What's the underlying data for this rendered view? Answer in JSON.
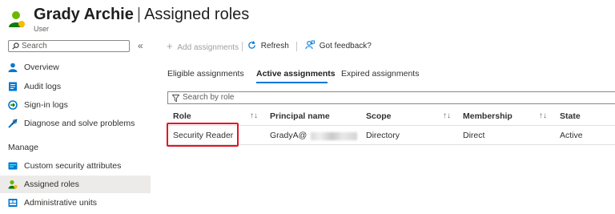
{
  "header": {
    "name": "Grady Archie",
    "separator": "|",
    "page": "Assigned roles",
    "more": "···",
    "subtitle": "User"
  },
  "sidebar": {
    "search_placeholder": "Search",
    "collapse": "«",
    "items": [
      {
        "label": "Overview",
        "icon": "person-icon"
      },
      {
        "label": "Audit logs",
        "icon": "audit-log-icon"
      },
      {
        "label": "Sign-in logs",
        "icon": "sign-in-icon"
      },
      {
        "label": "Diagnose and solve problems",
        "icon": "wrench-icon"
      }
    ],
    "section": "Manage",
    "manage_items": [
      {
        "label": "Custom security attributes",
        "icon": "attributes-icon"
      },
      {
        "label": "Assigned roles",
        "icon": "assigned-roles-icon",
        "active": true
      },
      {
        "label": "Administrative units",
        "icon": "admin-units-icon"
      }
    ]
  },
  "toolbar": {
    "add": "Add assignments",
    "refresh": "Refresh",
    "feedback": "Got feedback?"
  },
  "tabs": [
    {
      "label": "Eligible assignments"
    },
    {
      "label": "Active assignments",
      "active": true
    },
    {
      "label": "Expired assignments"
    }
  ],
  "filter": {
    "placeholder": "Search by role"
  },
  "table": {
    "columns": [
      "Role",
      "Principal name",
      "Scope",
      "Membership",
      "State"
    ],
    "sort_glyph": "↑↓",
    "rows": [
      {
        "role": "Security Reader",
        "principal": "GradyA@",
        "scope": "Directory",
        "membership": "Direct",
        "state": "Active"
      }
    ]
  },
  "colors": {
    "accent": "#0078d4",
    "highlight": "#e81123"
  }
}
